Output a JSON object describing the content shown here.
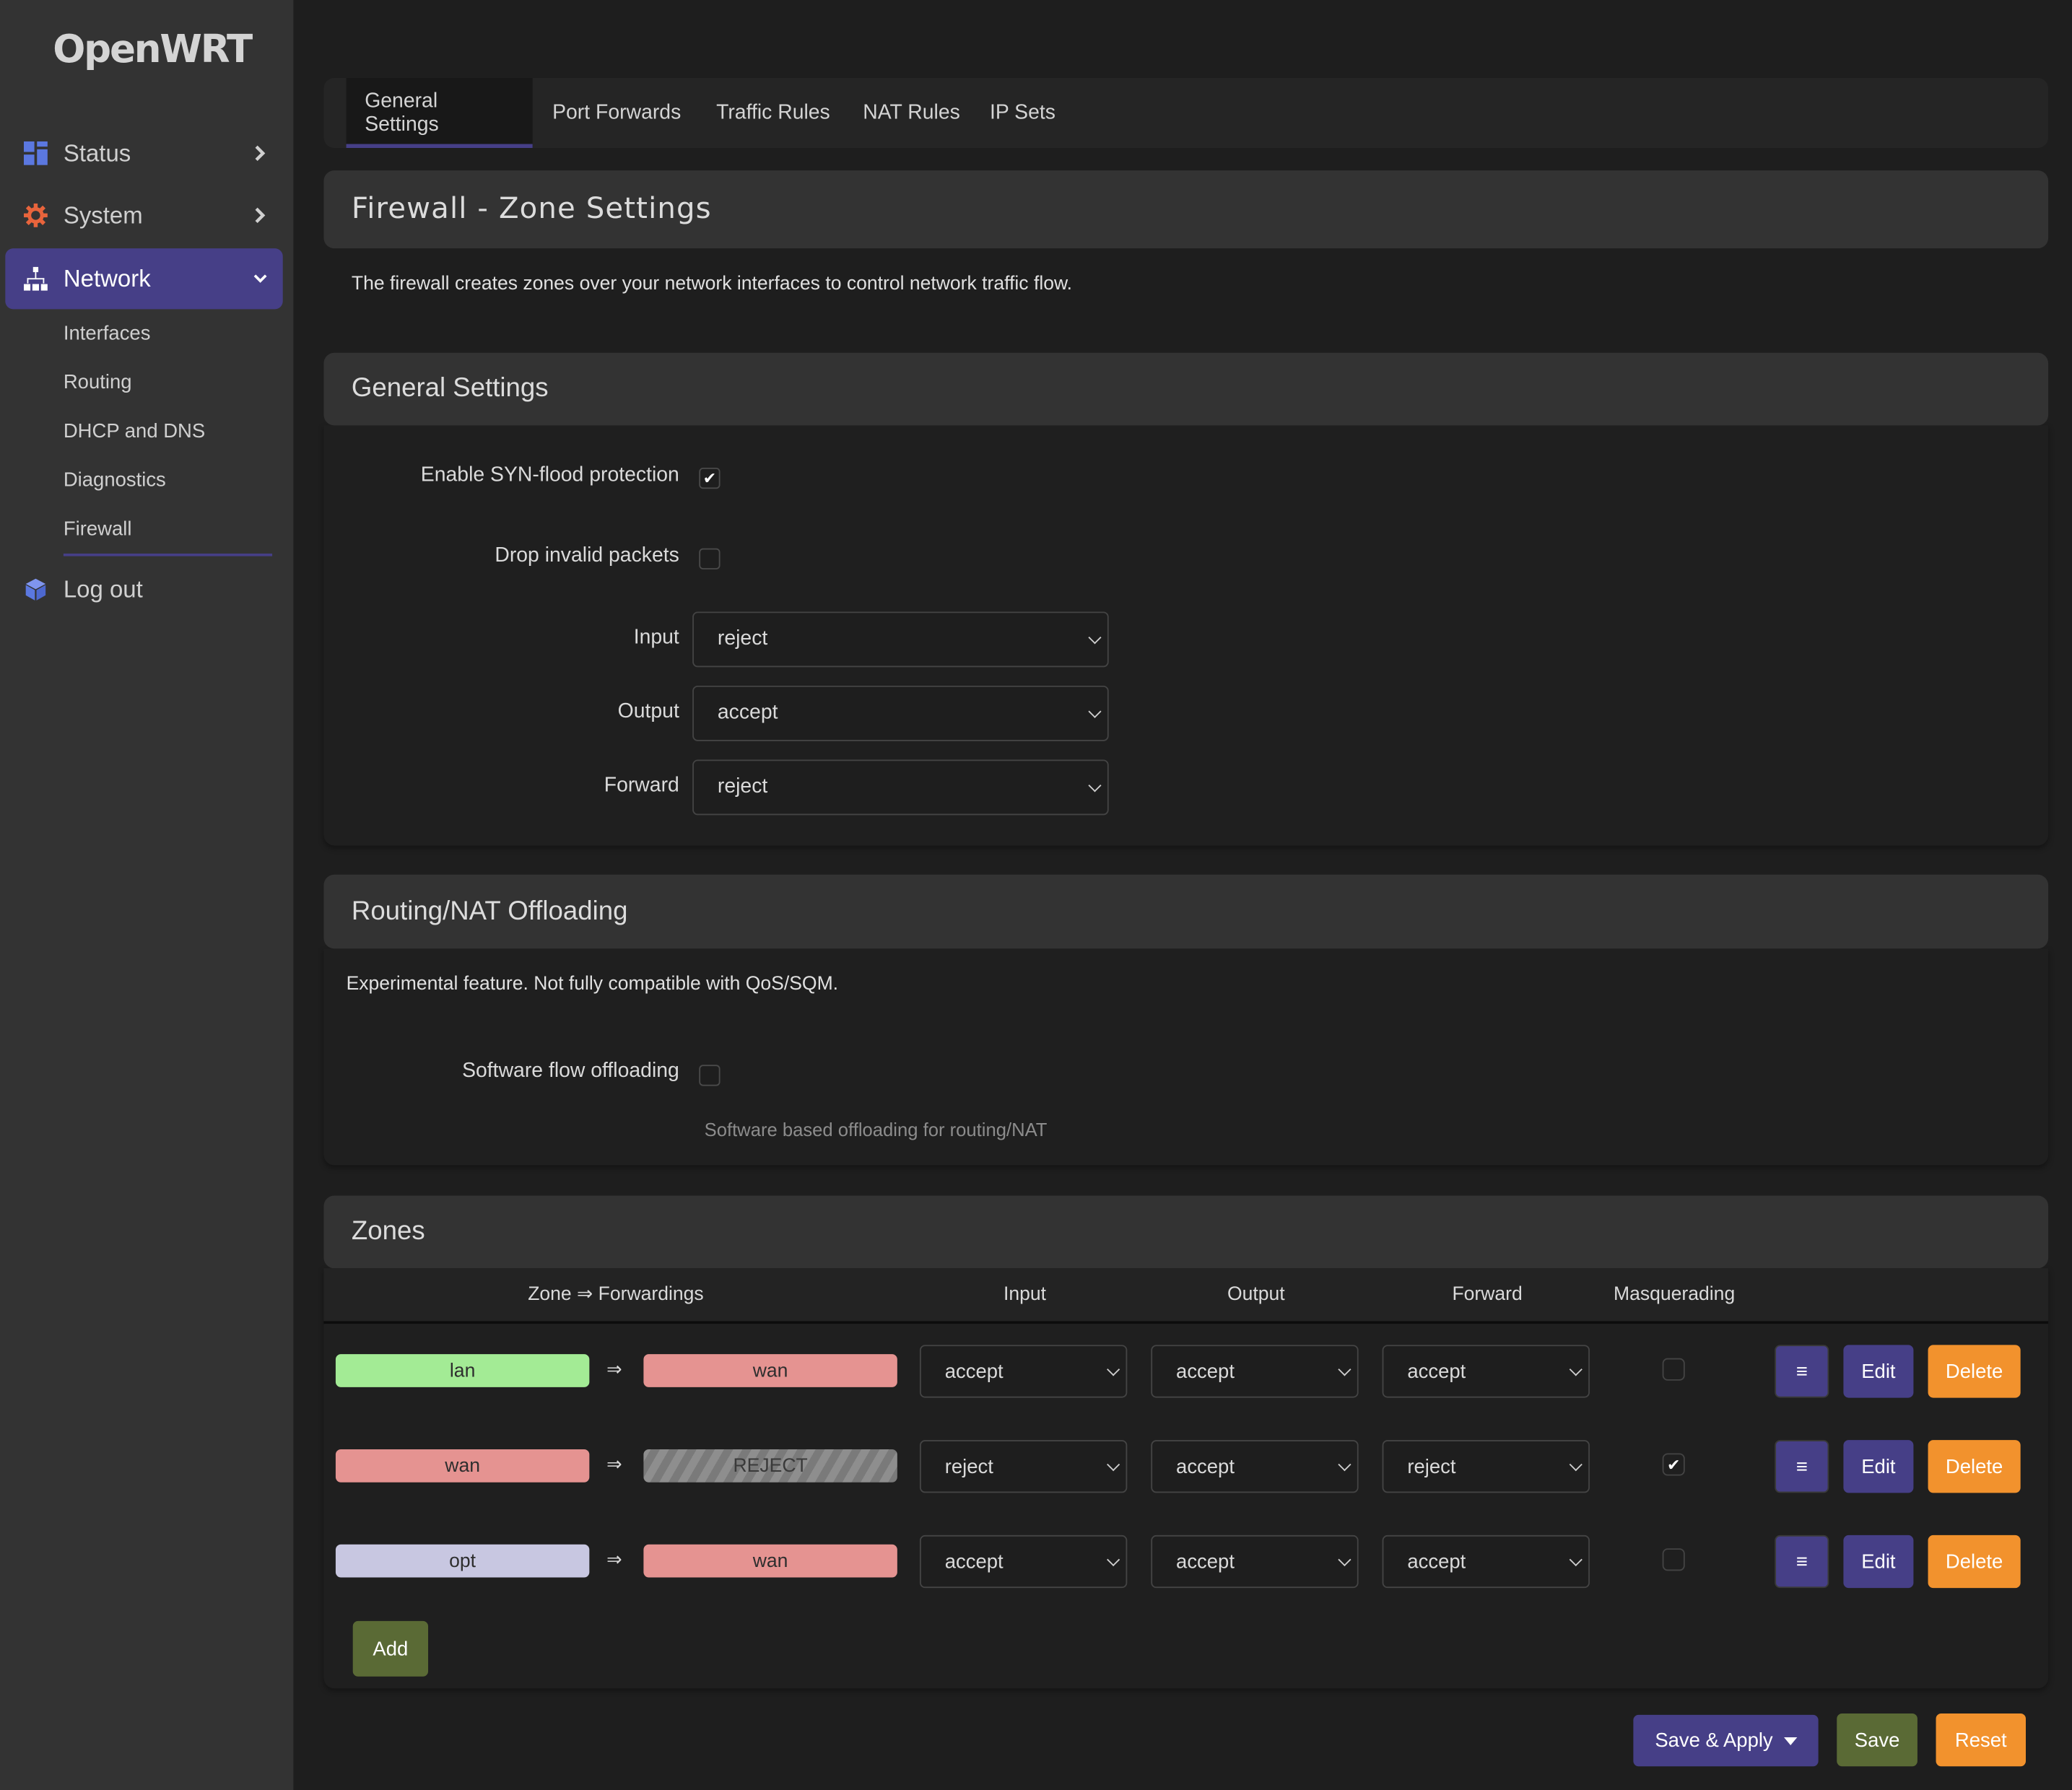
{
  "brand": {
    "logo_text": "OpenWRT"
  },
  "sidebar": {
    "items": [
      {
        "label": "Status",
        "icon": "dashboard-icon",
        "expanded": false
      },
      {
        "label": "System",
        "icon": "gear-icon",
        "expanded": false
      },
      {
        "label": "Network",
        "icon": "network-icon",
        "expanded": true,
        "active": true
      },
      {
        "label": "Log out",
        "icon": "cube-icon"
      }
    ],
    "network_subitems": [
      {
        "label": "Interfaces"
      },
      {
        "label": "Routing"
      },
      {
        "label": "DHCP and DNS"
      },
      {
        "label": "Diagnostics"
      },
      {
        "label": "Firewall",
        "active": true
      }
    ]
  },
  "tabs": [
    {
      "label": "General Settings",
      "active": true
    },
    {
      "label": "Port Forwards"
    },
    {
      "label": "Traffic Rules"
    },
    {
      "label": "NAT Rules"
    },
    {
      "label": "IP Sets"
    }
  ],
  "page": {
    "title": "Firewall - Zone Settings",
    "description": "The firewall creates zones over your network interfaces to control network traffic flow."
  },
  "general_settings": {
    "title": "General Settings",
    "syn_flood": {
      "label": "Enable SYN-flood protection",
      "checked": true
    },
    "drop_invalid": {
      "label": "Drop invalid packets",
      "checked": false
    },
    "input": {
      "label": "Input",
      "value": "reject"
    },
    "output": {
      "label": "Output",
      "value": "accept"
    },
    "forward": {
      "label": "Forward",
      "value": "reject"
    }
  },
  "offloading": {
    "title": "Routing/NAT Offloading",
    "description": "Experimental feature. Not fully compatible with QoS/SQM.",
    "software_flow": {
      "label": "Software flow offloading",
      "checked": false,
      "hint": "Software based offloading for routing/NAT"
    }
  },
  "zones": {
    "title": "Zones",
    "columns": [
      "Zone ⇒ Forwardings",
      "Input",
      "Output",
      "Forward",
      "Masquerading"
    ],
    "forward_arrow": "⇒",
    "rows": [
      {
        "zone": "lan",
        "zone_color": "#a3eb95",
        "forward_to": "wan",
        "forward_color": "#e59391",
        "forward_striped": false,
        "input": "accept",
        "output": "accept",
        "forward": "accept",
        "masquerading": false
      },
      {
        "zone": "wan",
        "zone_color": "#e59391",
        "forward_to": "REJECT",
        "forward_color": "#808080",
        "forward_striped": true,
        "input": "reject",
        "output": "accept",
        "forward": "reject",
        "masquerading": true
      },
      {
        "zone": "opt",
        "zone_color": "#c8c7e1",
        "forward_to": "wan",
        "forward_color": "#e59391",
        "forward_striped": false,
        "input": "accept",
        "output": "accept",
        "forward": "accept",
        "masquerading": false
      }
    ],
    "row_buttons": {
      "drag": "≡",
      "edit": "Edit",
      "delete": "Delete"
    },
    "add_label": "Add"
  },
  "footer": {
    "save_apply": "Save & Apply",
    "save": "Save",
    "reset": "Reset"
  },
  "colors": {
    "accent": "#463f87",
    "danger": "#f2922d",
    "positive": "#5a6a35",
    "sidebar_bg": "#333333",
    "page_bg": "#1e1e1e"
  }
}
